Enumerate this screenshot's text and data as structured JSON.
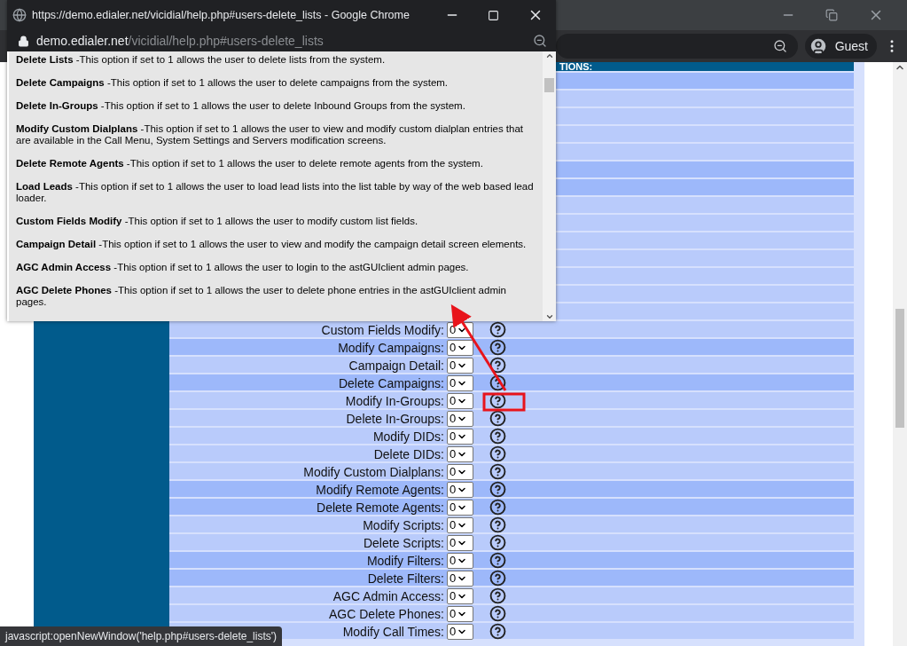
{
  "browser": {
    "profile": "Guest"
  },
  "section_header": "TIONS:",
  "permissions": [
    {
      "label": "Custom Fields Modify:",
      "value": "0",
      "highlighted": false
    },
    {
      "label": "Modify Campaigns:",
      "value": "0",
      "highlighted": true
    },
    {
      "label": "Campaign Detail:",
      "value": "0",
      "highlighted": false
    },
    {
      "label": "Delete Campaigns:",
      "value": "0",
      "highlighted": true
    },
    {
      "label": "Modify In-Groups:",
      "value": "0",
      "highlighted": false
    },
    {
      "label": "Delete In-Groups:",
      "value": "0",
      "highlighted": false
    },
    {
      "label": "Modify DIDs:",
      "value": "0",
      "highlighted": false
    },
    {
      "label": "Delete DIDs:",
      "value": "0",
      "highlighted": false
    },
    {
      "label": "Modify Custom Dialplans:",
      "value": "0",
      "highlighted": false
    },
    {
      "label": "Modify Remote Agents:",
      "value": "0",
      "highlighted": true
    },
    {
      "label": "Delete Remote Agents:",
      "value": "0",
      "highlighted": true
    },
    {
      "label": "Modify Scripts:",
      "value": "0",
      "highlighted": false
    },
    {
      "label": "Delete Scripts:",
      "value": "0",
      "highlighted": false
    },
    {
      "label": "Modify Filters:",
      "value": "0",
      "highlighted": true
    },
    {
      "label": "Delete Filters:",
      "value": "0",
      "highlighted": true
    },
    {
      "label": "AGC Admin Access:",
      "value": "0",
      "highlighted": false
    },
    {
      "label": "AGC Delete Phones:",
      "value": "0",
      "highlighted": false
    },
    {
      "label": "Modify Call Times:",
      "value": "0",
      "highlighted": false
    }
  ],
  "status_url": "javascript:openNewWindow('help.php#users-delete_lists')",
  "popup": {
    "title": "https://demo.edialer.net/vicidial/help.php#users-delete_lists - Google Chrome",
    "url_host": "demo.edialer.net",
    "url_path": "/vicidial/help.php#users-delete_lists",
    "entries": [
      {
        "term": "Delete Lists",
        "text": "-This option if set to 1 allows the user to delete lists from the system."
      },
      {
        "term": "Delete Campaigns",
        "text": "-This option if set to 1 allows the user to delete campaigns from the system."
      },
      {
        "term": "Delete In-Groups",
        "text": "-This option if set to 1 allows the user to delete Inbound Groups from the system."
      },
      {
        "term": "Modify Custom Dialplans",
        "text": "-This option if set to 1 allows the user to view and modify custom dialplan entries that are available in the Call Menu, System Settings and Servers modification screens."
      },
      {
        "term": "Delete Remote Agents",
        "text": "-This option if set to 1 allows the user to delete remote agents from the system."
      },
      {
        "term": "Load Leads",
        "text": "-This option if set to 1 allows the user to load lead lists into the list table by way of the web based lead loader."
      },
      {
        "term": "Custom Fields Modify",
        "text": "-This option if set to 1 allows the user to modify custom list fields."
      },
      {
        "term": "Campaign Detail",
        "text": "-This option if set to 1 allows the user to view and modify the campaign detail screen elements."
      },
      {
        "term": "AGC Admin Access",
        "text": "-This option if set to 1 allows the user to login to the astGUIclient admin pages."
      },
      {
        "term": "AGC Delete Phones",
        "text": "-This option if set to 1 allows the user to delete phone entries in the astGUIclient admin pages."
      }
    ]
  }
}
